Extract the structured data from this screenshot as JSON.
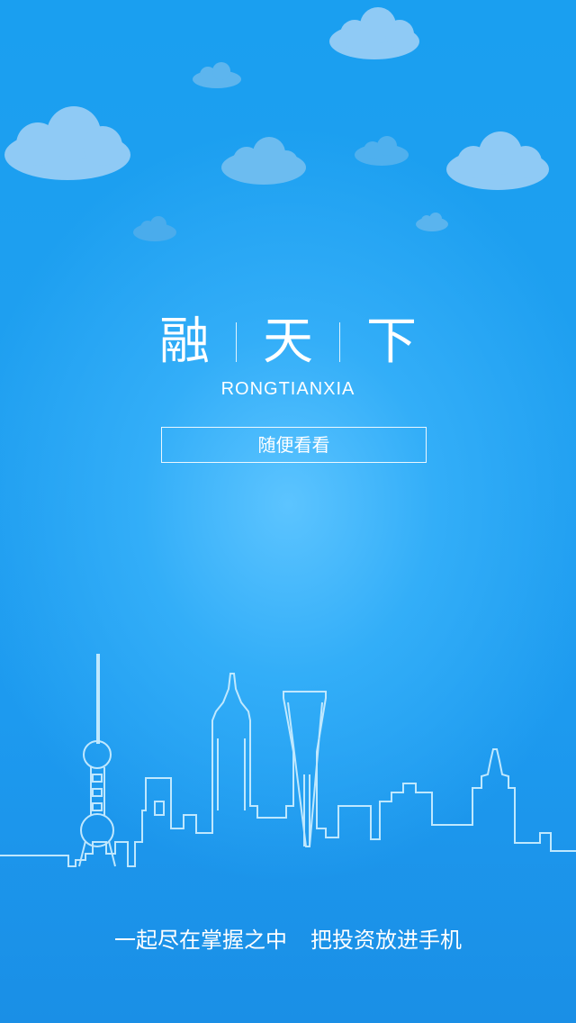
{
  "app": {
    "logo_chars": [
      "融",
      "天",
      "下"
    ],
    "subtitle": "RONGTIANXIA"
  },
  "actions": {
    "browse_label": "随便看看"
  },
  "footer": {
    "tagline_part1": "一起尽在掌握之中",
    "tagline_part2": "把投资放进手机"
  },
  "icons": {
    "clouds": "cloud-icon",
    "skyline": "city-skyline-illustration"
  },
  "colors": {
    "background_top": "#1a9ff0",
    "background_glow": "#5cc4ff",
    "cloud": "#8fcaf5",
    "foreground": "#ffffff"
  }
}
